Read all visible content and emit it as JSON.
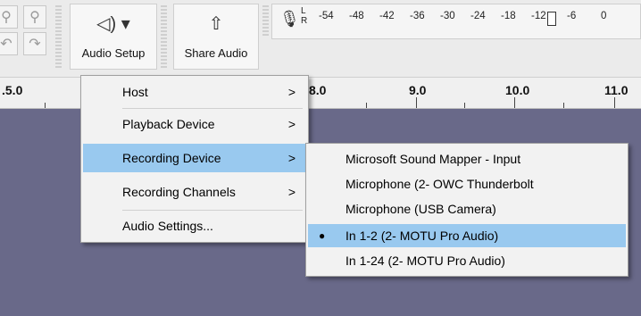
{
  "toolbar": {
    "audio_setup": {
      "label": "Audio Setup",
      "icon": "speaker-dropdown-icon",
      "icon_glyph": "◁) ▾"
    },
    "share_audio": {
      "label": "Share Audio",
      "icon": "share-upload-icon",
      "icon_glyph": "⇧"
    },
    "meter": {
      "channels": [
        "L",
        "R"
      ],
      "ticks": [
        "-54",
        "-48",
        "-42",
        "-36",
        "-30",
        "-24",
        "-18",
        "-12",
        "-6",
        "0"
      ]
    }
  },
  "ruler": {
    "labels": [
      ".5.0",
      "8.0",
      "9.0",
      "10.0",
      "11.0"
    ]
  },
  "audio_setup_menu": {
    "items": [
      {
        "label": "Host",
        "submenu": ">"
      },
      {
        "label": "Playback Device",
        "submenu": ">"
      },
      {
        "label": "Recording Device",
        "submenu": ">"
      },
      {
        "label": "Recording Channels",
        "submenu": ">"
      },
      {
        "label": "Audio Settings..."
      }
    ],
    "highlighted_index": 2
  },
  "recording_device_submenu": {
    "items": [
      {
        "label": "Microsoft Sound Mapper - Input"
      },
      {
        "label": "Microphone (2- OWC Thunderbolt"
      },
      {
        "label": "Microphone (USB  Camera)"
      },
      {
        "label": "In 1-2 (2- MOTU Pro Audio)",
        "selected_mark": "●"
      },
      {
        "label": "In 1-24 (2- MOTU Pro Audio)"
      }
    ],
    "highlighted_index": 3
  },
  "colors": {
    "highlight": "#99c9ef",
    "track_background": "#696989"
  }
}
